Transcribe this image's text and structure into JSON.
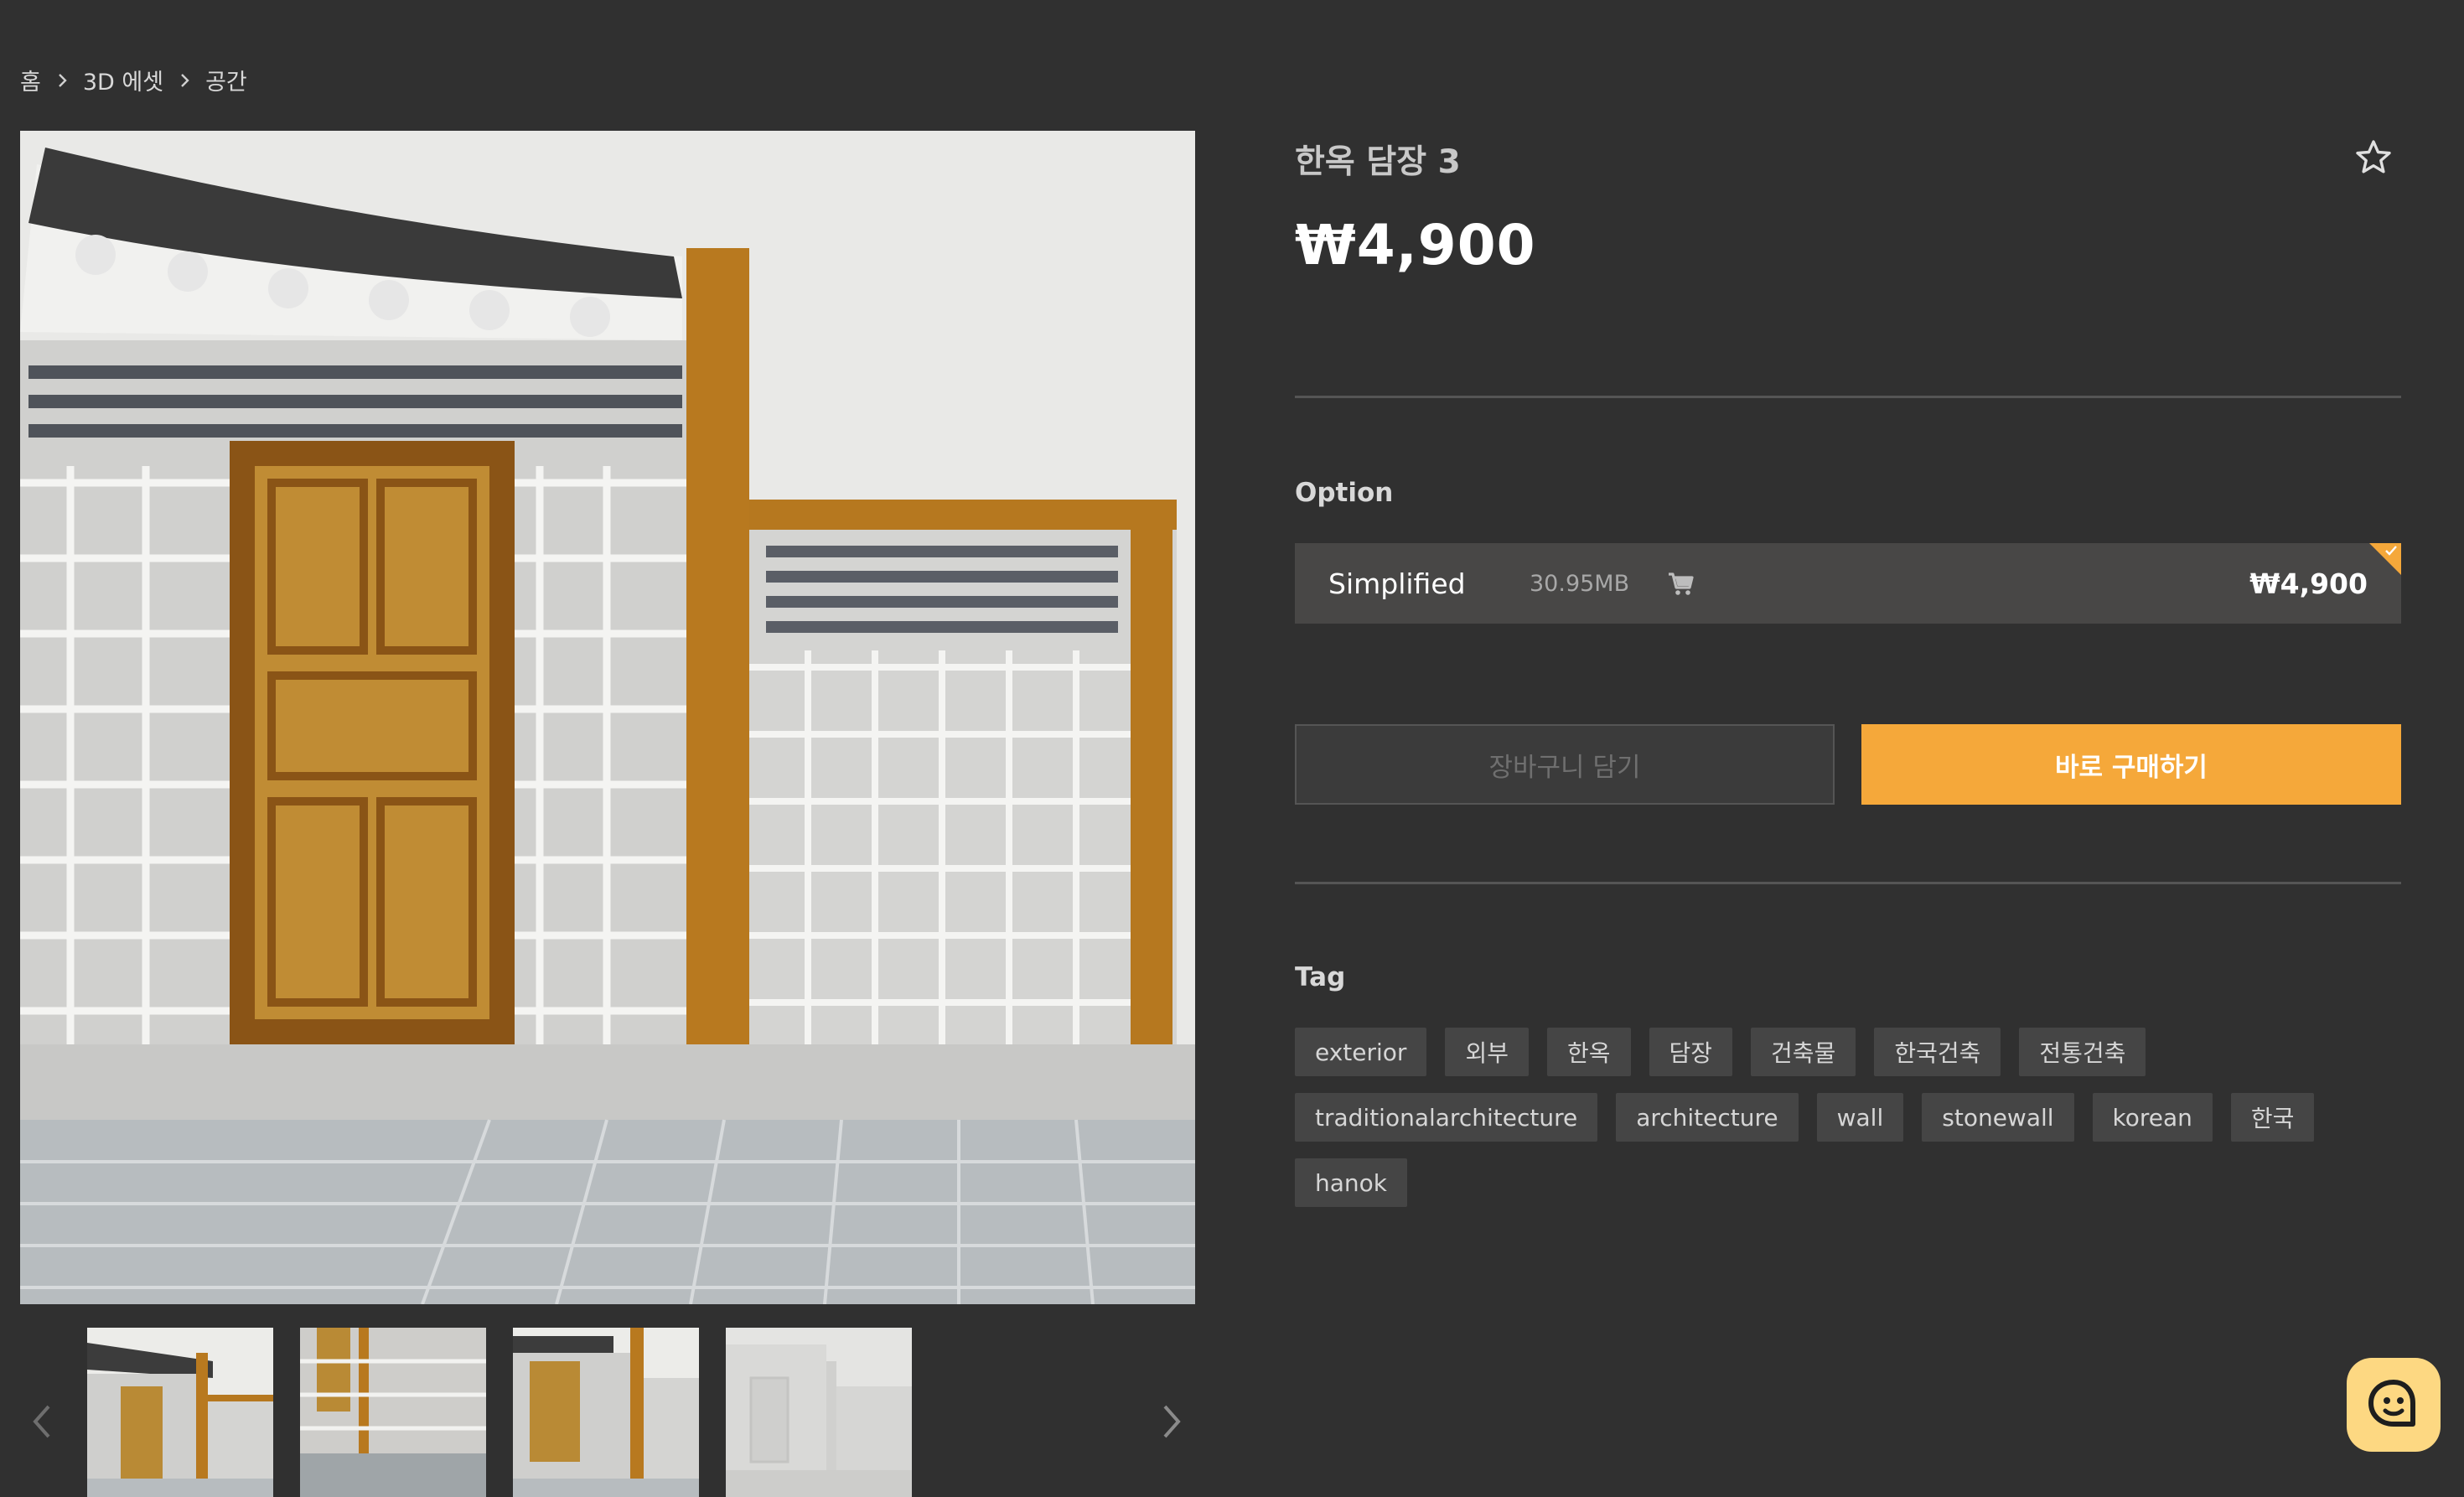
{
  "breadcrumb": [
    "홈",
    "3D 에셋",
    "공간"
  ],
  "product": {
    "title": "한옥 담장 3",
    "price": "₩4,900"
  },
  "option_section": {
    "label": "Option",
    "option": {
      "name": "Simplified",
      "size": "30.95MB",
      "price": "₩4,900",
      "selected": true
    }
  },
  "buttons": {
    "add_to_cart": "장바구니 담기",
    "buy_now": "바로 구매하기"
  },
  "tag_section": {
    "label": "Tag",
    "tags": [
      "exterior",
      "외부",
      "한옥",
      "담장",
      "건축물",
      "한국건축",
      "전통건축",
      "traditionalarchitecture",
      "architecture",
      "wall",
      "stonewall",
      "korean",
      "한국",
      "hanok"
    ]
  },
  "icons": {
    "favorite": "star-outline-icon",
    "cart": "cart-icon",
    "chat": "chat-icon",
    "prev": "chevron-left-icon",
    "next": "chevron-right-icon"
  },
  "colors": {
    "background": "#303030",
    "accent": "#f5a83a",
    "chat": "#fdd882"
  },
  "thumbnails": [
    "thumb-1",
    "thumb-2",
    "thumb-3",
    "thumb-4"
  ]
}
